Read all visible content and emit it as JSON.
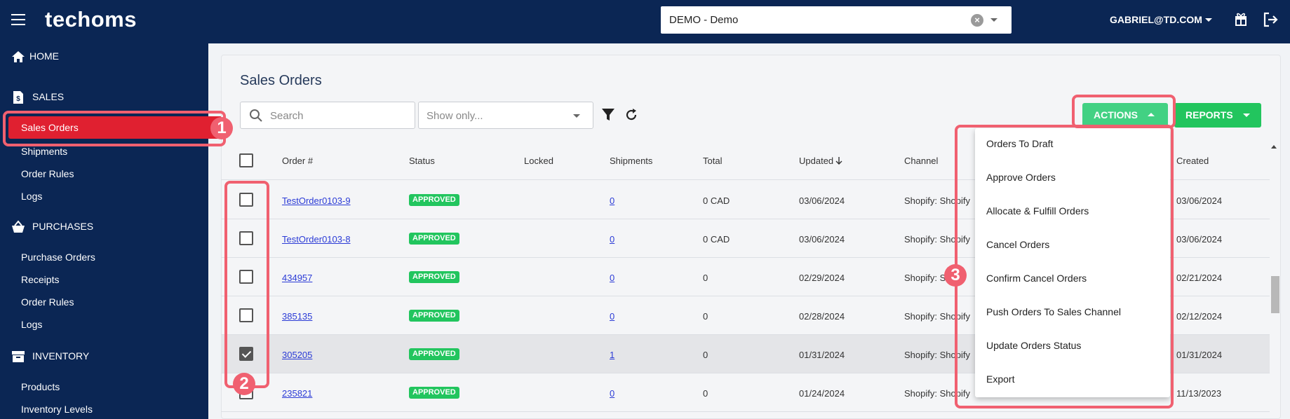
{
  "app": {
    "logo": "techoms",
    "tenant": "DEMO - Demo",
    "user": "GABRIEL@TD.COM"
  },
  "sidebar": {
    "sections": [
      {
        "label": "HOME",
        "icon": "home-icon"
      },
      {
        "label": "SALES",
        "icon": "sales-icon",
        "items": [
          "Sales Orders",
          "Shipments",
          "Order Rules",
          "Logs"
        ]
      },
      {
        "label": "PURCHASES",
        "icon": "basket-icon",
        "items": [
          "Purchase Orders",
          "Receipts",
          "Order Rules",
          "Logs"
        ]
      },
      {
        "label": "INVENTORY",
        "icon": "inventory-icon",
        "items": [
          "Products",
          "Inventory Levels"
        ]
      }
    ],
    "active_item": "Sales Orders"
  },
  "page": {
    "title": "Sales Orders",
    "search_placeholder": "Search",
    "show_only_placeholder": "Show only...",
    "actions_label": "ACTIONS",
    "reports_label": "REPORTS"
  },
  "table": {
    "columns": [
      "Order #",
      "Status",
      "Locked",
      "Shipments",
      "Total",
      "Updated",
      "Channel",
      "Created"
    ],
    "rows": [
      {
        "order": "TestOrder0103-9",
        "status": "APPROVED",
        "locked": "",
        "shipments": "0",
        "total": "0 CAD",
        "updated": "03/06/2024",
        "channel": "Shopify: Shopify",
        "created": "03/06/2024",
        "checked": false
      },
      {
        "order": "TestOrder0103-8",
        "status": "APPROVED",
        "locked": "",
        "shipments": "0",
        "total": "0 CAD",
        "updated": "03/06/2024",
        "channel": "Shopify: Shopify",
        "created": "03/06/2024",
        "checked": false
      },
      {
        "order": "434957",
        "status": "APPROVED",
        "locked": "",
        "shipments": "0",
        "total": "0",
        "updated": "02/29/2024",
        "channel": "Shopify: S",
        "created": "02/21/2024",
        "checked": false
      },
      {
        "order": "385135",
        "status": "APPROVED",
        "locked": "",
        "shipments": "0",
        "total": "0",
        "updated": "02/28/2024",
        "channel": "Shopify: Shopify",
        "created": "02/12/2024",
        "checked": false
      },
      {
        "order": "305205",
        "status": "APPROVED",
        "locked": "",
        "shipments": "1",
        "total": "0",
        "updated": "01/31/2024",
        "channel": "Shopify: Shopify",
        "created": "01/31/2024",
        "checked": true
      },
      {
        "order": "235821",
        "status": "APPROVED",
        "locked": "",
        "shipments": "0",
        "total": "0",
        "updated": "01/24/2024",
        "channel": "Shopify: Shopify",
        "created": "11/13/2023",
        "checked": false
      }
    ]
  },
  "actions_menu": [
    "Orders To Draft",
    "Approve Orders",
    "Allocate & Fulfill Orders",
    "Cancel Orders",
    "Confirm Cancel Orders",
    "Push Orders To Sales Channel",
    "Update Orders Status",
    "Export"
  ],
  "annotations": [
    "1",
    "2",
    "3"
  ],
  "colors": {
    "navy": "#0b2654",
    "active_red": "#e02030",
    "green": "#22c55e",
    "annotation": "#f06070",
    "link": "#2b3bd6"
  }
}
